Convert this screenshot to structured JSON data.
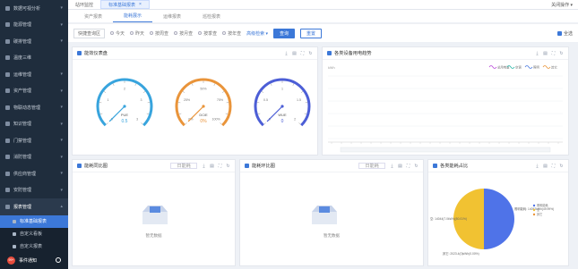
{
  "sidebar": {
    "items": [
      {
        "label": "数据可视分析",
        "arrow": "▾"
      },
      {
        "label": "能源管理",
        "arrow": "▾"
      },
      {
        "label": "碳排管理",
        "arrow": "▾"
      },
      {
        "label": "温度三维",
        "arrow": ""
      },
      {
        "label": "运维管理",
        "arrow": "▾"
      },
      {
        "label": "资产管理",
        "arrow": "▾"
      },
      {
        "label": "物联动态管理",
        "arrow": "▾"
      },
      {
        "label": "知识管理",
        "arrow": "▾"
      },
      {
        "label": "门禁管理",
        "arrow": "▾"
      },
      {
        "label": "消防管理",
        "arrow": "▾"
      },
      {
        "label": "供应商管理",
        "arrow": "▾"
      },
      {
        "label": "安防管理",
        "arrow": "▾"
      }
    ],
    "active": {
      "label": "报表管理",
      "arrow": "▴"
    },
    "subs": [
      "标准基础报表",
      "自定义看板",
      "自定义报表",
      "报告管理"
    ],
    "notif": {
      "label": "事件通知",
      "badge": "99+"
    }
  },
  "top": {
    "tabs": [
      "站环监控",
      "标准基础报表"
    ],
    "close_ops": "关闭操作 ▾"
  },
  "subtabs": [
    "资产报表",
    "能耗展示",
    "运维报表",
    "巡检报表"
  ],
  "filters": {
    "quick": "快捷查询区",
    "radios": [
      "今天",
      "昨天",
      "按周查",
      "按月查",
      "按季查",
      "按年查"
    ],
    "advanced": "高级检索 ▾",
    "query": "查询",
    "reset": "重置",
    "select_all": "全选"
  },
  "cards": {
    "gauge_title": "能效仪表盘",
    "trend_title": "各类设备用电趋势",
    "ring_title": "能耗同比图",
    "chain_title": "能耗环比图",
    "pie_title": "各类能耗占比",
    "select_placeholder": "日能耗",
    "nodata": "暂无数据"
  },
  "gauges": [
    {
      "name": "PUE",
      "value": "0.5",
      "color": "#38a4dd",
      "ticks": [
        "1",
        "2",
        "3"
      ],
      "start": "0",
      "end": "3"
    },
    {
      "name": "DCiE",
      "value": "0%",
      "color": "#e9943a",
      "ticks": [
        "25%",
        "50%",
        "75%"
      ],
      "start": "0%",
      "end": "100%"
    },
    {
      "name": "WUE",
      "value": "0",
      "color": "#4c5ed6",
      "ticks": [
        "0.5",
        "1",
        "1.5"
      ],
      "start": "0",
      "end": "2"
    }
  ],
  "trend": {
    "ylabel": "kWh",
    "legend": [
      "总用电量",
      "空调",
      "照明",
      "其它"
    ],
    "colors": [
      "#b94bd9",
      "#2bb7a8",
      "#4c7be0",
      "#e9943a"
    ]
  },
  "chart_data": {
    "type": "pie",
    "title": "各类能耗占比",
    "slices": [
      {
        "name": "照明能耗",
        "label": "照明能耗: 14052kWh(49.99%)",
        "value": 14052,
        "pct": 49.99,
        "color": "#4f73e8"
      },
      {
        "name": "空调",
        "label": "空: 14044(7.0kWh)(50.01%)",
        "value": 14044,
        "pct": 50.01,
        "color": "#f1c232"
      },
      {
        "name": "其它",
        "label": "其它: 2023.4(0)kWh(0.00%)",
        "value": 0,
        "pct": 0,
        "color": "#e9943a"
      }
    ],
    "legend": [
      "照明能耗",
      "空",
      "其它"
    ]
  }
}
